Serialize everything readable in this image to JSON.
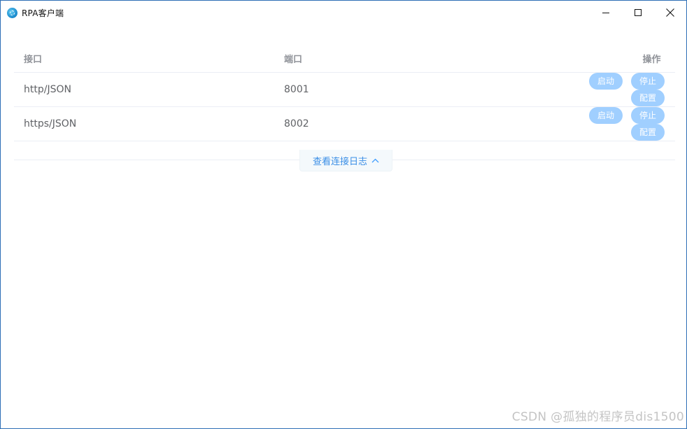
{
  "window": {
    "title": "RPA客户端",
    "controls": {
      "minimize": "minimize-icon",
      "maximize": "maximize-icon",
      "close": "close-icon"
    }
  },
  "table": {
    "headers": {
      "interface": "接口",
      "port": "端口",
      "actions": "操作"
    },
    "rows": [
      {
        "interface": "http/JSON",
        "port": "8001"
      },
      {
        "interface": "https/JSON",
        "port": "8002"
      }
    ],
    "action_labels": {
      "start": "启动",
      "stop": "停止",
      "config": "配置"
    }
  },
  "log_toggle": {
    "label": "查看连接日志",
    "icon": "chevron-up-icon"
  },
  "watermark": "CSDN @孤独的程序员dis1500",
  "colors": {
    "accent": "#409eff",
    "button_disabled_bg": "#a0cfff",
    "header_text": "#909399",
    "body_text": "#606266",
    "border": "#2d6fb6"
  }
}
